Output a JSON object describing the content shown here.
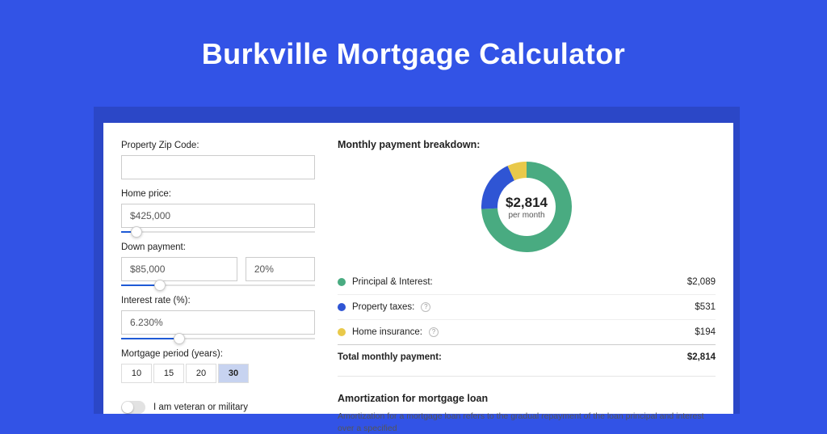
{
  "hero": {
    "title": "Burkville Mortgage Calculator"
  },
  "form": {
    "zip": {
      "label": "Property Zip Code:",
      "value": ""
    },
    "home_price": {
      "label": "Home price:",
      "value": "$425,000",
      "slider_pct": 8
    },
    "down_payment": {
      "label": "Down payment:",
      "amount": "$85,000",
      "pct": "20%",
      "slider_pct": 20
    },
    "interest": {
      "label": "Interest rate (%):",
      "value": "6.230%",
      "slider_pct": 30
    },
    "period": {
      "label": "Mortgage period (years):",
      "options": [
        "10",
        "15",
        "20",
        "30"
      ],
      "active_index": 3
    },
    "veteran": {
      "label": "I am veteran or military",
      "on": false
    }
  },
  "breakdown": {
    "title": "Monthly payment breakdown:",
    "center_amount": "$2,814",
    "center_sub": "per month",
    "items": [
      {
        "label": "Principal & Interest:",
        "value": "$2,089",
        "color": "#49ab81",
        "help": false
      },
      {
        "label": "Property taxes:",
        "value": "$531",
        "color": "#2f55d4",
        "help": true
      },
      {
        "label": "Home insurance:",
        "value": "$194",
        "color": "#e9c94a",
        "help": true
      }
    ],
    "total": {
      "label": "Total monthly payment:",
      "value": "$2,814"
    }
  },
  "amort": {
    "title": "Amortization for mortgage loan",
    "body": "Amortization for a mortgage loan refers to the gradual repayment of the loan principal and interest over a specified"
  },
  "chart_data": {
    "type": "pie",
    "title": "Monthly payment breakdown",
    "categories": [
      "Principal & Interest",
      "Property taxes",
      "Home insurance"
    ],
    "values": [
      2089,
      531,
      194
    ],
    "colors": [
      "#49ab81",
      "#2f55d4",
      "#e9c94a"
    ],
    "total": 2814
  }
}
